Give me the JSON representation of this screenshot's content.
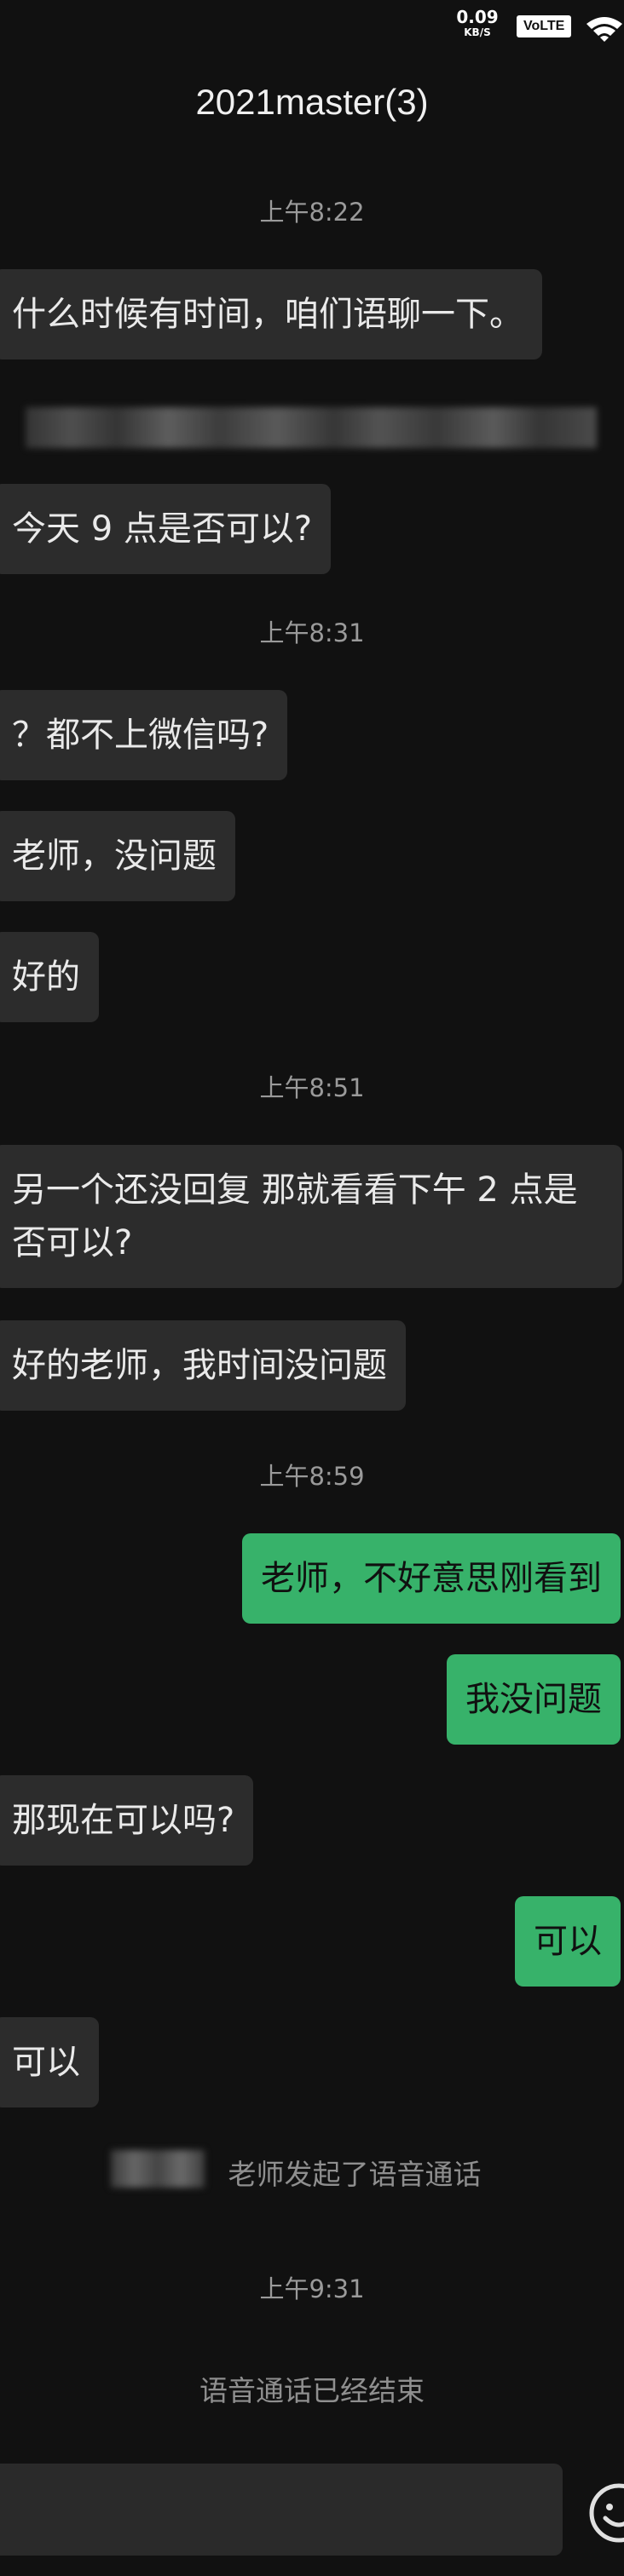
{
  "status_bar": {
    "net_speed_value": "0.09",
    "net_speed_unit": "KB/S",
    "network_badge": "VoLTE",
    "wifi_icon": "wifi-icon"
  },
  "header": {
    "title": "2021master(3)"
  },
  "messages": [
    {
      "type": "time",
      "text": "上午8:22"
    },
    {
      "type": "incoming",
      "text": "什么时候有时间，咱们语聊一下。"
    },
    {
      "type": "incoming",
      "text": "今天 9 点是否可以?"
    },
    {
      "type": "time",
      "text": "上午8:31"
    },
    {
      "type": "incoming",
      "text": "？都不上微信吗?"
    },
    {
      "type": "incoming",
      "text": "老师，没问题"
    },
    {
      "type": "incoming",
      "text": "好的"
    },
    {
      "type": "time",
      "text": "上午8:51"
    },
    {
      "type": "incoming",
      "text": "另一个还没回复 那就看看下午 2 点是否可以?"
    },
    {
      "type": "incoming",
      "text": "好的老师，我时间没问题"
    },
    {
      "type": "time",
      "text": "上午8:59"
    },
    {
      "type": "outgoing",
      "text": "老师，不好意思刚看到"
    },
    {
      "type": "outgoing",
      "text": "我没问题"
    },
    {
      "type": "incoming",
      "text": "那现在可以吗?"
    },
    {
      "type": "outgoing",
      "text": "可以"
    },
    {
      "type": "incoming",
      "text": "可以"
    },
    {
      "type": "system",
      "text": "老师发起了语音通话"
    },
    {
      "type": "time",
      "text": "上午9:31"
    },
    {
      "type": "system",
      "text": "语音通话已经结束"
    }
  ],
  "input": {
    "value": "",
    "emoji_icon": "emoji-face-icon"
  },
  "colors": {
    "background": "#111111",
    "incoming_bubble": "#2c2c2c",
    "outgoing_bubble": "#37b26a",
    "timestamp_text": "#9a9a9a"
  }
}
